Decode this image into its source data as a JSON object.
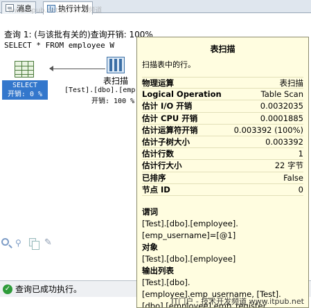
{
  "watermark_top": "www.itpub.net 技术开发频道",
  "tabs": [
    {
      "label": "消息",
      "icon": "messages-icon",
      "active": false
    },
    {
      "label": "执行计划",
      "icon": "execution-plan-icon",
      "active": true
    }
  ],
  "query": {
    "header": "查询 1: (与该批有关的)查询开销: 100%",
    "sql": "SELECT * FROM employee W"
  },
  "plan": {
    "select_node": {
      "label": "SELECT",
      "cost": "开销: 0 %"
    },
    "scan_node": {
      "title": "表扫描",
      "object": "[Test].[dbo].[emp",
      "cost": "开销: 100 %"
    }
  },
  "tooltip": {
    "title": "表扫描",
    "description": "扫描表中的行。",
    "properties": [
      {
        "key": "物理运算",
        "value": "表扫描"
      },
      {
        "key": "Logical Operation",
        "value": "Table Scan"
      },
      {
        "key": "估计 I/O 开销",
        "value": "0.0032035"
      },
      {
        "key": "估计 CPU 开销",
        "value": "0.0001885"
      },
      {
        "key": "估计运算符开销",
        "value": "0.003392 (100%)"
      },
      {
        "key": "估计子树大小",
        "value": "0.003392"
      },
      {
        "key": "估计行数",
        "value": "1"
      },
      {
        "key": "估计行大小",
        "value": "22 字节"
      },
      {
        "key": "已排序",
        "value": "False"
      },
      {
        "key": "节点 ID",
        "value": "0"
      }
    ],
    "sections": {
      "predicate_heading": "谓词",
      "predicate_lines": [
        "[Test].[dbo].[employee].",
        "[emp_username]=[@1]"
      ],
      "object_heading": "对象",
      "object_lines": [
        "[Test].[dbo].[employee]"
      ],
      "output_heading": "输出列表",
      "output_lines": [
        "[Test].[dbo].",
        "[employee].emp_username, [Test].",
        "[dbo].[employee].emp_register"
      ]
    }
  },
  "status": {
    "text": "查询已成功执行。",
    "icon": "success-check-icon"
  },
  "watermark_bottom": "IT门户 - 技术开发频道 www.itpub.net",
  "colors": {
    "select_highlight": "#3377cc",
    "tooltip_background": "#fffde0",
    "success": "#2e9b3a"
  }
}
